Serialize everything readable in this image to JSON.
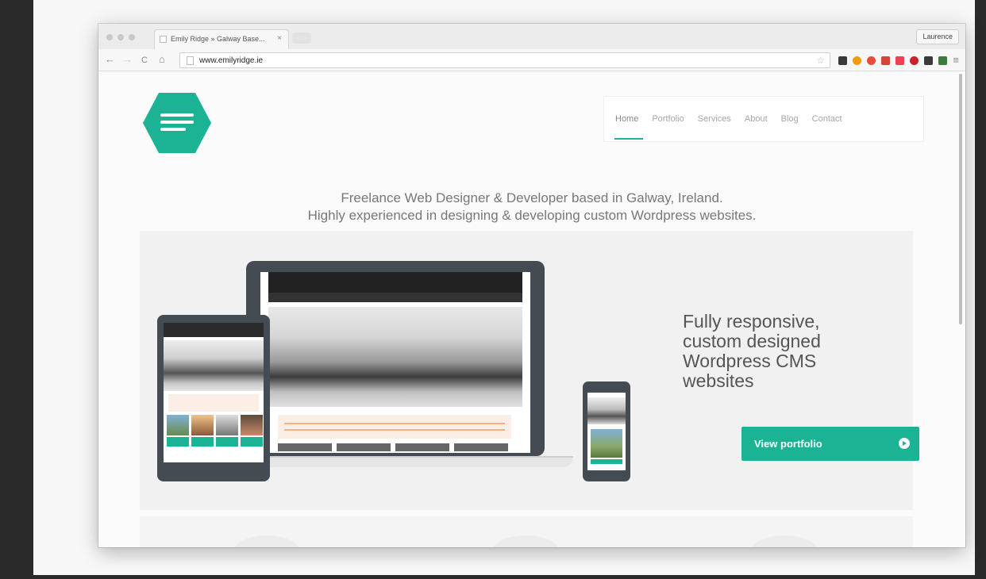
{
  "browser": {
    "tab_title": "Emily Ridge » Galway Base...",
    "tab_close": "×",
    "profile_name": "Laurence",
    "url": "www.emilyridge.ie",
    "back": "←",
    "forward": "→",
    "reload": "C",
    "home": "⌂",
    "star": "☆",
    "menu": "≡",
    "extensions": [
      {
        "name": "layers-icon",
        "color": "#3a3a3a"
      },
      {
        "name": "orange-square-icon",
        "color": "#f39c12"
      },
      {
        "name": "opera-icon",
        "color": "#e74c3c"
      },
      {
        "name": "gmail-icon",
        "color": "#d44638"
      },
      {
        "name": "pocket-icon",
        "color": "#ef4056"
      },
      {
        "name": "pinterest-icon",
        "color": "#cb2027"
      },
      {
        "name": "evernote-icon",
        "color": "#3a3a3a"
      },
      {
        "name": "chat-icon",
        "color": "#3a7d3a"
      }
    ]
  },
  "site": {
    "nav": [
      "Home",
      "Portfolio",
      "Services",
      "About",
      "Blog",
      "Contact"
    ],
    "active_nav": "Home",
    "tagline_line1": "Freelance Web Designer & Developer based in Galway, Ireland.",
    "tagline_line2": "Highly experienced in designing & developing custom Wordpress websites.",
    "hero_heading": "Fully responsive, custom designed Wordpress CMS websites",
    "cta_label": "View portfolio",
    "accent": "#1bb394"
  }
}
